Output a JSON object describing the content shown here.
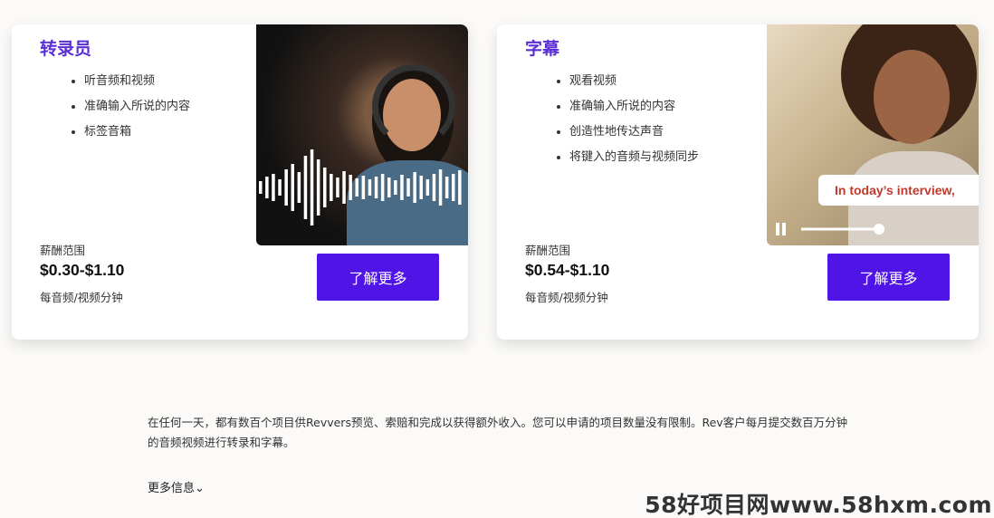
{
  "cards": [
    {
      "title": "转录员",
      "bullets": [
        "听音频和视频",
        "准确输入所说的内容",
        "标签音箱"
      ],
      "pay_label": "薪酬范围",
      "pay_range": "$0.30-$1.10",
      "pay_unit": "每音频/视频分钟",
      "cta_label": "了解更多"
    },
    {
      "title": "字幕",
      "bullets": [
        "观看视频",
        "准确输入所说的内容",
        "创造性地传达声音",
        "将键入的音频与视频同步"
      ],
      "pay_label": "薪酬范围",
      "pay_range": "$0.54-$1.10",
      "pay_unit": "每音频/视频分钟",
      "cta_label": "了解更多",
      "caption": "In today’s interview,"
    }
  ],
  "intro_text": "在任何一天，都有数百个项目供Revvers预览、索赔和完成以获得额外收入。您可以申请的项目数量没有限制。Rev客户每月提交数百万分钟的音频视频进行转录和字幕。",
  "more_info_label": "更多信息",
  "watermark": "58好项目网www.58hxm.com",
  "colors": {
    "accent": "#5014e6",
    "title": "#5b2fd6",
    "caption": "#c0392b"
  },
  "icons": {
    "more_info": "chevron-down-icon",
    "player": "pause-icon"
  }
}
